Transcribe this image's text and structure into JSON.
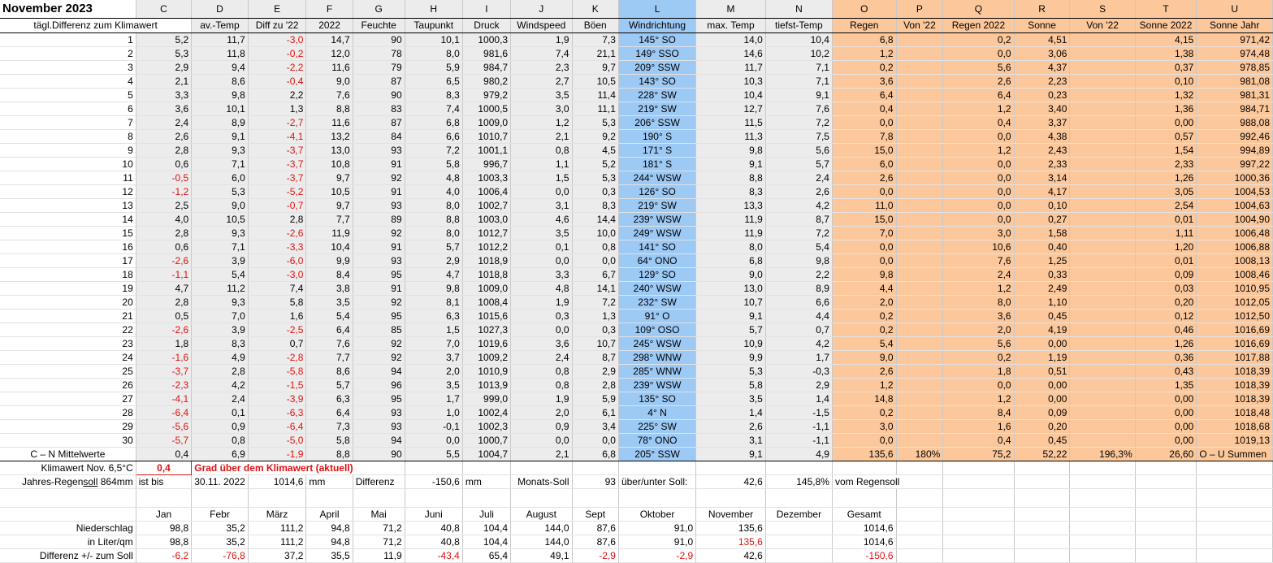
{
  "title": "November 2023",
  "col_letters": [
    "C",
    "D",
    "E",
    "F",
    "G",
    "H",
    "I",
    "J",
    "K",
    "L",
    "M",
    "N",
    "O",
    "P",
    "Q",
    "R",
    "S",
    "T",
    "U"
  ],
  "row_header_label": "tägl.Differenz zum Klimawert",
  "col_headers": [
    "av.-Temp",
    "Diff zu '22",
    "2022",
    "Feuchte",
    "Taupunkt",
    "Druck",
    "Windspeed",
    "Böen",
    "Windrichtung",
    "max. Temp",
    "tiefst-Temp",
    "Regen",
    "Von '22",
    "Regen 2022",
    "Sonne",
    "Von '22",
    "Sonne 2022",
    "Sonne Jahr"
  ],
  "rows": [
    [
      "1",
      "5,2",
      "11,7",
      "-3,0",
      "14,7",
      "90",
      "10,1",
      "1000,3",
      "1,9",
      "7,3",
      "145° SO",
      "14,0",
      "10,4",
      "6,8",
      "",
      "0,2",
      "4,51",
      "",
      "4,15",
      "971,42"
    ],
    [
      "2",
      "5,3",
      "11,8",
      "-0,2",
      "12,0",
      "78",
      "8,0",
      "981,6",
      "7,4",
      "21,1",
      "149° SSO",
      "14,6",
      "10,2",
      "1,2",
      "",
      "0,0",
      "3,06",
      "",
      "1,38",
      "974,48"
    ],
    [
      "3",
      "2,9",
      "9,4",
      "-2,2",
      "11,6",
      "79",
      "5,9",
      "984,7",
      "2,3",
      "9,7",
      "209° SSW",
      "11,7",
      "7,1",
      "0,2",
      "",
      "5,6",
      "4,37",
      "",
      "0,37",
      "978,85"
    ],
    [
      "4",
      "2,1",
      "8,6",
      "-0,4",
      "9,0",
      "87",
      "6,5",
      "980,2",
      "2,7",
      "10,5",
      "143° SO",
      "10,3",
      "7,1",
      "3,6",
      "",
      "2,6",
      "2,23",
      "",
      "0,10",
      "981,08"
    ],
    [
      "5",
      "3,3",
      "9,8",
      "2,2",
      "7,6",
      "90",
      "8,3",
      "979,2",
      "3,5",
      "11,4",
      "228° SW",
      "10,4",
      "9,1",
      "6,4",
      "",
      "6,4",
      "0,23",
      "",
      "1,32",
      "981,31"
    ],
    [
      "6",
      "3,6",
      "10,1",
      "1,3",
      "8,8",
      "83",
      "7,4",
      "1000,5",
      "3,0",
      "11,1",
      "219° SW",
      "12,7",
      "7,6",
      "0,4",
      "",
      "1,2",
      "3,40",
      "",
      "1,36",
      "984,71"
    ],
    [
      "7",
      "2,4",
      "8,9",
      "-2,7",
      "11,6",
      "87",
      "6,8",
      "1009,0",
      "1,2",
      "5,3",
      "206° SSW",
      "11,5",
      "7,2",
      "0,0",
      "",
      "0,4",
      "3,37",
      "",
      "0,00",
      "988,08"
    ],
    [
      "8",
      "2,6",
      "9,1",
      "-4,1",
      "13,2",
      "84",
      "6,6",
      "1010,7",
      "2,1",
      "9,2",
      "190° S",
      "11,3",
      "7,5",
      "7,8",
      "",
      "0,0",
      "4,38",
      "",
      "0,57",
      "992,46"
    ],
    [
      "9",
      "2,8",
      "9,3",
      "-3,7",
      "13,0",
      "93",
      "7,2",
      "1001,1",
      "0,8",
      "4,5",
      "171° S",
      "9,8",
      "5,6",
      "15,0",
      "",
      "1,2",
      "2,43",
      "",
      "1,54",
      "994,89"
    ],
    [
      "10",
      "0,6",
      "7,1",
      "-3,7",
      "10,8",
      "91",
      "5,8",
      "996,7",
      "1,1",
      "5,2",
      "181° S",
      "9,1",
      "5,7",
      "6,0",
      "",
      "0,0",
      "2,33",
      "",
      "2,33",
      "997,22"
    ],
    [
      "11",
      "-0,5",
      "6,0",
      "-3,7",
      "9,7",
      "92",
      "4,8",
      "1003,3",
      "1,5",
      "5,3",
      "244° WSW",
      "8,8",
      "2,4",
      "2,6",
      "",
      "0,0",
      "3,14",
      "",
      "1,26",
      "1000,36"
    ],
    [
      "12",
      "-1,2",
      "5,3",
      "-5,2",
      "10,5",
      "91",
      "4,0",
      "1006,4",
      "0,0",
      "0,3",
      "126° SO",
      "8,3",
      "2,6",
      "0,0",
      "",
      "0,0",
      "4,17",
      "",
      "3,05",
      "1004,53"
    ],
    [
      "13",
      "2,5",
      "9,0",
      "-0,7",
      "9,7",
      "93",
      "8,0",
      "1002,7",
      "3,1",
      "8,3",
      "219° SW",
      "13,3",
      "4,2",
      "11,0",
      "",
      "0,0",
      "0,10",
      "",
      "2,54",
      "1004,63"
    ],
    [
      "14",
      "4,0",
      "10,5",
      "2,8",
      "7,7",
      "89",
      "8,8",
      "1003,0",
      "4,6",
      "14,4",
      "239° WSW",
      "11,9",
      "8,7",
      "15,0",
      "",
      "0,0",
      "0,27",
      "",
      "0,01",
      "1004,90"
    ],
    [
      "15",
      "2,8",
      "9,3",
      "-2,6",
      "11,9",
      "92",
      "8,0",
      "1012,7",
      "3,5",
      "10,0",
      "249° WSW",
      "11,9",
      "7,2",
      "7,0",
      "",
      "3,0",
      "1,58",
      "",
      "1,11",
      "1006,48"
    ],
    [
      "16",
      "0,6",
      "7,1",
      "-3,3",
      "10,4",
      "91",
      "5,7",
      "1012,2",
      "0,1",
      "0,8",
      "141° SO",
      "8,0",
      "5,4",
      "0,0",
      "",
      "10,6",
      "0,40",
      "",
      "1,20",
      "1006,88"
    ],
    [
      "17",
      "-2,6",
      "3,9",
      "-6,0",
      "9,9",
      "93",
      "2,9",
      "1018,9",
      "0,0",
      "0,0",
      "64° ONO",
      "6,8",
      "9,8",
      "0,0",
      "",
      "7,6",
      "1,25",
      "",
      "0,01",
      "1008,13"
    ],
    [
      "18",
      "-1,1",
      "5,4",
      "-3,0",
      "8,4",
      "95",
      "4,7",
      "1018,8",
      "3,3",
      "6,7",
      "129° SO",
      "9,0",
      "2,2",
      "9,8",
      "",
      "2,4",
      "0,33",
      "",
      "0,09",
      "1008,46"
    ],
    [
      "19",
      "4,7",
      "11,2",
      "7,4",
      "3,8",
      "91",
      "9,8",
      "1009,0",
      "4,8",
      "14,1",
      "240° WSW",
      "13,0",
      "8,9",
      "4,4",
      "",
      "1,2",
      "2,49",
      "",
      "0,03",
      "1010,95"
    ],
    [
      "20",
      "2,8",
      "9,3",
      "5,8",
      "3,5",
      "92",
      "8,1",
      "1008,4",
      "1,9",
      "7,2",
      "232° SW",
      "10,7",
      "6,6",
      "2,0",
      "",
      "8,0",
      "1,10",
      "",
      "0,20",
      "1012,05"
    ],
    [
      "21",
      "0,5",
      "7,0",
      "1,6",
      "5,4",
      "95",
      "6,3",
      "1015,6",
      "0,3",
      "1,3",
      "91° O",
      "9,1",
      "4,4",
      "0,2",
      "",
      "3,6",
      "0,45",
      "",
      "0,12",
      "1012,50"
    ],
    [
      "22",
      "-2,6",
      "3,9",
      "-2,5",
      "6,4",
      "85",
      "1,5",
      "1027,3",
      "0,0",
      "0,3",
      "109° OSO",
      "5,7",
      "0,7",
      "0,2",
      "",
      "2,0",
      "4,19",
      "",
      "0,46",
      "1016,69"
    ],
    [
      "23",
      "1,8",
      "8,3",
      "0,7",
      "7,6",
      "92",
      "7,0",
      "1019,6",
      "3,6",
      "10,7",
      "245° WSW",
      "10,9",
      "4,2",
      "5,4",
      "",
      "5,6",
      "0,00",
      "",
      "1,26",
      "1016,69"
    ],
    [
      "24",
      "-1,6",
      "4,9",
      "-2,8",
      "7,7",
      "92",
      "3,7",
      "1009,2",
      "2,4",
      "8,7",
      "298° WNW",
      "9,9",
      "1,7",
      "9,0",
      "",
      "0,2",
      "1,19",
      "",
      "0,36",
      "1017,88"
    ],
    [
      "25",
      "-3,7",
      "2,8",
      "-5,8",
      "8,6",
      "94",
      "2,0",
      "1010,9",
      "0,8",
      "2,9",
      "285° WNW",
      "5,3",
      "-0,3",
      "2,6",
      "",
      "1,8",
      "0,51",
      "",
      "0,43",
      "1018,39"
    ],
    [
      "26",
      "-2,3",
      "4,2",
      "-1,5",
      "5,7",
      "96",
      "3,5",
      "1013,9",
      "0,8",
      "2,8",
      "239° WSW",
      "5,8",
      "2,9",
      "1,2",
      "",
      "0,0",
      "0,00",
      "",
      "1,35",
      "1018,39"
    ],
    [
      "27",
      "-4,1",
      "2,4",
      "-3,9",
      "6,3",
      "95",
      "1,7",
      "999,0",
      "1,9",
      "5,9",
      "135° SO",
      "3,5",
      "1,4",
      "14,8",
      "",
      "1,2",
      "0,00",
      "",
      "0,00",
      "1018,39"
    ],
    [
      "28",
      "-6,4",
      "0,1",
      "-6,3",
      "6,4",
      "93",
      "1,0",
      "1002,4",
      "2,0",
      "6,1",
      "4° N",
      "1,4",
      "-1,5",
      "0,2",
      "",
      "8,4",
      "0,09",
      "",
      "0,00",
      "1018,48"
    ],
    [
      "29",
      "-5,6",
      "0,9",
      "-6,4",
      "7,3",
      "93",
      "-0,1",
      "1002,3",
      "0,9",
      "3,4",
      "225° SW",
      "2,6",
      "-1,1",
      "3,0",
      "",
      "1,6",
      "0,20",
      "",
      "0,00",
      "1018,68"
    ],
    [
      "30",
      "-5,7",
      "0,8",
      "-5,0",
      "5,8",
      "94",
      "0,0",
      "1000,7",
      "0,0",
      "0,0",
      "78° ONO",
      "3,1",
      "-1,1",
      "0,0",
      "",
      "0,4",
      "0,45",
      "",
      "0,00",
      "1019,13"
    ]
  ],
  "mean_row": [
    "C – N Mittelwerte",
    "0,4",
    "6,9",
    "-1,9",
    "8,8",
    "90",
    "5,5",
    "1004,7",
    "2,1",
    "6,8",
    "205° SSW",
    "9,1",
    "4,9",
    "135,6",
    "180%",
    "75,2",
    "52,22",
    "196,3%",
    "26,60",
    "O – U Summen"
  ],
  "klima": {
    "label": "Klimawert Nov. 6,5°C",
    "value": "0,4",
    "text": "Grad über dem Klimawert (aktuell)"
  },
  "jahres": {
    "label_pre": "Jahres-Regen",
    "label_soll": "soll",
    "label_post": " 864mm",
    "ist_bis": "ist bis",
    "date": "30.11. 2022",
    "amount": "1014,6",
    "unit": "mm",
    "diff_label": "Differenz",
    "diff_value": "-150,6",
    "diff_unit": "mm",
    "monats_label": "Monats-Soll",
    "monats_value": "93",
    "ueber_label": "über/unter Soll:",
    "ueber_value": "42,6",
    "percent": "145,8%",
    "vom": "vom Regensoll"
  },
  "months": [
    "Jan",
    "Febr",
    "März",
    "April",
    "Mai",
    "Juni",
    "Juli",
    "August",
    "Sept",
    "Oktober",
    "November",
    "Dezember",
    "Gesamt"
  ],
  "niederschlag": {
    "label": "Niederschlag",
    "values": [
      "98,8",
      "35,2",
      "111,2",
      "94,8",
      "71,2",
      "40,8",
      "104,4",
      "144,0",
      "87,6",
      "91,0",
      "135,6",
      "",
      "1014,6"
    ]
  },
  "liter": {
    "label": "in Liter/qm",
    "values": [
      "98,8",
      "35,2",
      "111,2",
      "94,8",
      "71,2",
      "40,8",
      "104,4",
      "144,0",
      "87,6",
      "91,0",
      "135,6",
      "",
      "1014,6"
    ]
  },
  "differenz": {
    "label": "Differenz  +/- zum Soll",
    "values": [
      "-6,2",
      "-76,8",
      "37,2",
      "35,5",
      "11,9",
      "-43,4",
      "65,4",
      "49,1",
      "-2,9",
      "-2,9",
      "42,6",
      "",
      "-150,6"
    ]
  },
  "colors": {
    "gray": "#ececec",
    "blue": "#9dc9f5",
    "orange": "#fcc89b",
    "red": "#e01010"
  }
}
